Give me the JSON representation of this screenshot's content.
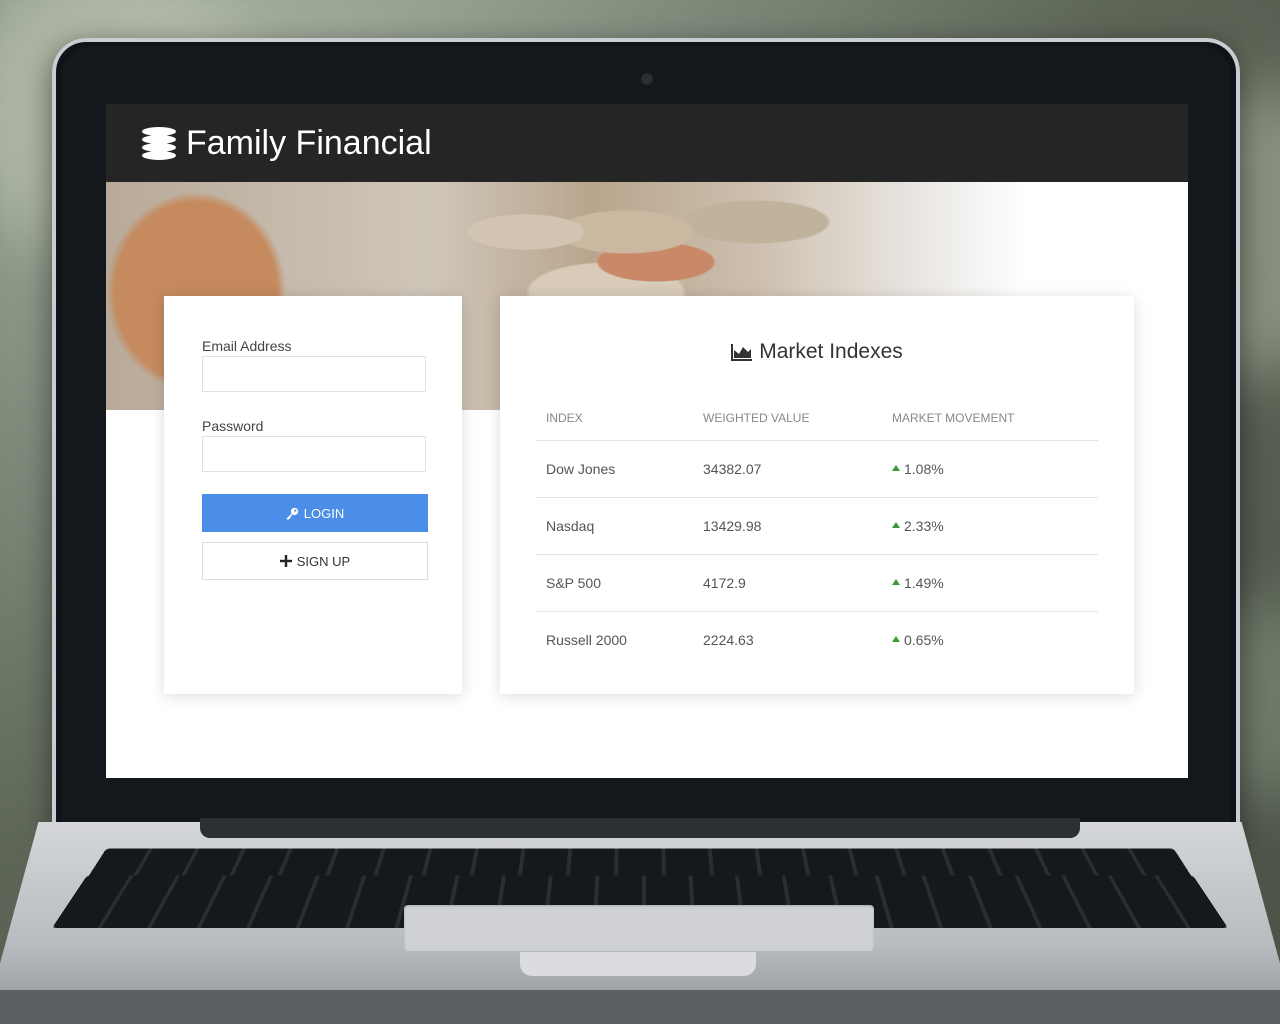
{
  "app": {
    "brand_name": "Family Financial",
    "brand_icon": "coins-icon"
  },
  "login": {
    "email_label": "Email Address",
    "email_value": "",
    "password_label": "Password",
    "password_value": "",
    "login_icon": "key-icon",
    "login_label": "LOGIN",
    "signup_icon": "plus-icon",
    "signup_label": "SIGN UP",
    "accent_color": "#4a8ee8"
  },
  "market": {
    "title": "Market Indexes",
    "title_icon": "area-chart-icon",
    "columns": [
      "INDEX",
      "WEIGHTED VALUE",
      "MARKET MOVEMENT"
    ],
    "rows": [
      {
        "index": "Dow Jones",
        "value": "34382.07",
        "movement": "1.08%",
        "direction": "up"
      },
      {
        "index": "Nasdaq",
        "value": "13429.98",
        "movement": "2.33%",
        "direction": "up"
      },
      {
        "index": "S&P 500",
        "value": "4172.9",
        "movement": "1.49%",
        "direction": "up"
      },
      {
        "index": "Russell 2000",
        "value": "2224.63",
        "movement": "0.65%",
        "direction": "up"
      }
    ],
    "up_color": "#3b9b3b"
  }
}
